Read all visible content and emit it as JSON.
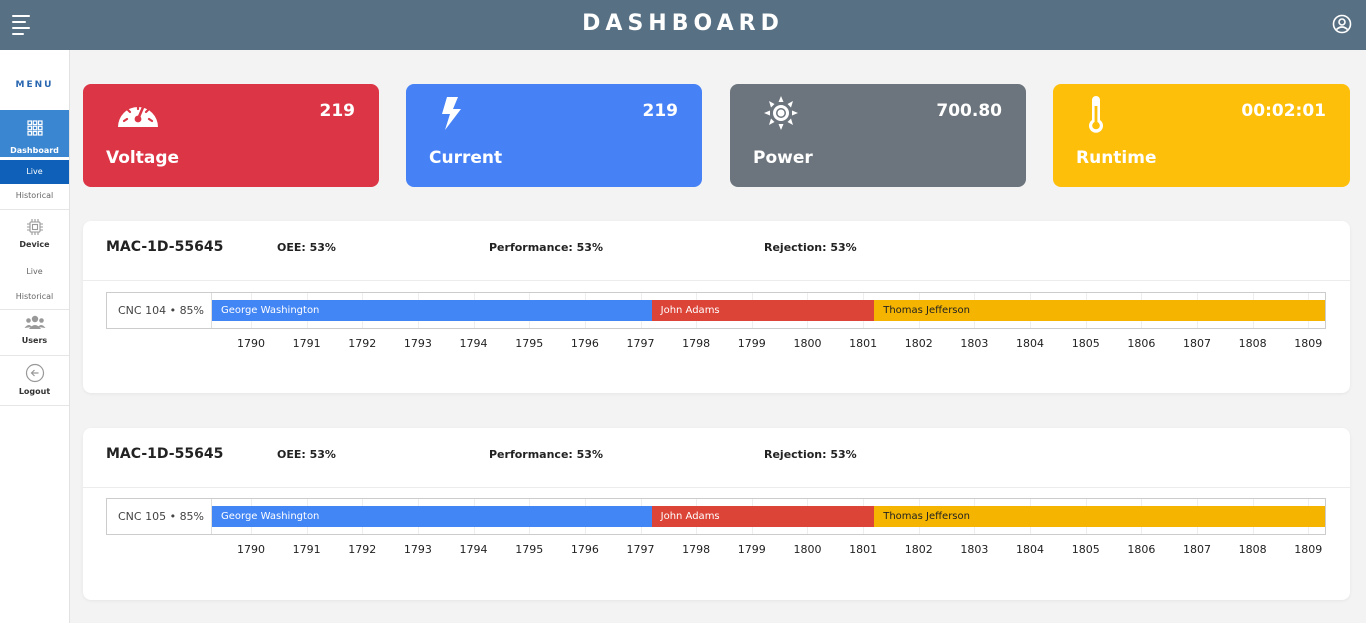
{
  "header": {
    "title": "DASHBOARD"
  },
  "sidebar": {
    "menu_title": "MENU",
    "dashboard": {
      "label": "Dashboard",
      "sub": [
        "Live",
        "Historical"
      ]
    },
    "device": {
      "label": "Device",
      "sub": [
        "Live",
        "Historical"
      ]
    },
    "users": {
      "label": "Users"
    },
    "logout": {
      "label": "Logout"
    }
  },
  "cards": [
    {
      "name": "Voltage",
      "value": "219",
      "icon": "gauge-icon",
      "color": "#dc3545"
    },
    {
      "name": "Current",
      "value": "219",
      "icon": "lightning-icon",
      "color": "#4682f6"
    },
    {
      "name": "Power",
      "value": "700.80",
      "icon": "sun-icon",
      "color": "#6c757d"
    },
    {
      "name": "Runtime",
      "value": "00:02:01",
      "icon": "thermometer-icon",
      "color": "#fdbf0a"
    }
  ],
  "machines": [
    {
      "id": "MAC-1D-55645",
      "oee": "OEE: 53%",
      "performance": "Performance: 53%",
      "rejection": "Rejection: 53%",
      "row_label": "CNC 104 • 85%",
      "segments": [
        {
          "label": "George Washington",
          "start": 1789.3,
          "end": 1797.2,
          "color": "#4285f4"
        },
        {
          "label": "John Adams",
          "start": 1797.2,
          "end": 1801.2,
          "color": "#db4437"
        },
        {
          "label": "Thomas Jefferson",
          "start": 1801.2,
          "end": 1809.3,
          "color": "#f4b400"
        }
      ]
    },
    {
      "id": "MAC-1D-55645",
      "oee": "OEE: 53%",
      "performance": "Performance: 53%",
      "rejection": "Rejection: 53%",
      "row_label": "CNC 105 • 85%",
      "segments": [
        {
          "label": "George Washington",
          "start": 1789.3,
          "end": 1797.2,
          "color": "#4285f4"
        },
        {
          "label": "John Adams",
          "start": 1797.2,
          "end": 1801.2,
          "color": "#db4437"
        },
        {
          "label": "Thomas Jefferson",
          "start": 1801.2,
          "end": 1809.3,
          "color": "#f4b400"
        }
      ]
    }
  ],
  "axis_years": [
    "1790",
    "1791",
    "1792",
    "1793",
    "1794",
    "1795",
    "1796",
    "1797",
    "1798",
    "1799",
    "1800",
    "1801",
    "1802",
    "1803",
    "1804",
    "1805",
    "1806",
    "1807",
    "1808",
    "1809"
  ]
}
